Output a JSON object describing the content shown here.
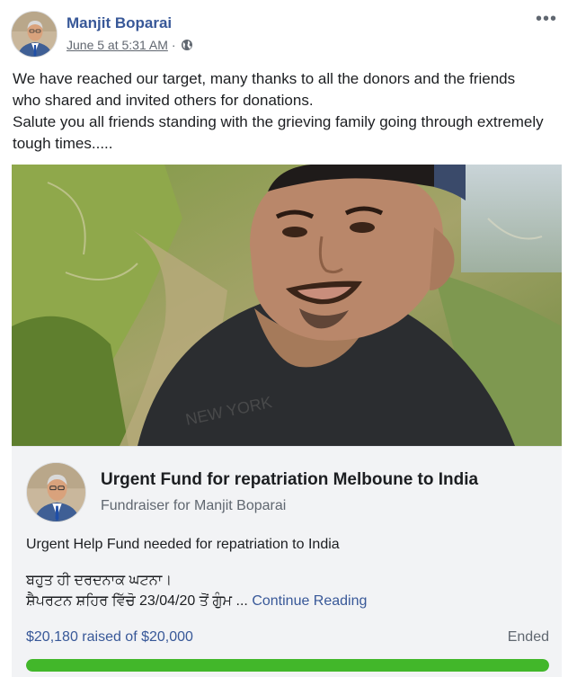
{
  "post": {
    "author": "Manjit Boparai",
    "timestamp": "June 5 at 5:31 AM",
    "separator": "·",
    "privacy_icon": "globe-icon",
    "more_label": "•••",
    "text_lines": [
      "We have reached our target, many thanks to all the donors and the friends",
      "who shared and invited others for donations.",
      "Salute you all friends standing with the grieving family going through extremely",
      "tough times....."
    ]
  },
  "fundraiser": {
    "title": "Urgent Fund for repatriation Melboune to India",
    "subtitle": "Fundraiser for Manjit Boparai",
    "description": "Urgent Help Fund needed for repatriation to India",
    "line1": "ਬਹੁਤ ਹੀ ਦਰਦਨਾਕ ਘਟਨਾ।",
    "line2": "ਸ਼ੈਪਰਟਨ ਸ਼ਹਿਰ ਵਿੱਚੋ 23/04/20 ਤੋਂ ਗੁੰਮ ...",
    "continue_label": "Continue Reading",
    "raised_text": "$20,180 raised of $20,000",
    "status": "Ended",
    "progress_fraction": 1.0
  },
  "colors": {
    "link": "#385898",
    "progress": "#42b72a",
    "card_bg": "#f2f3f5"
  }
}
